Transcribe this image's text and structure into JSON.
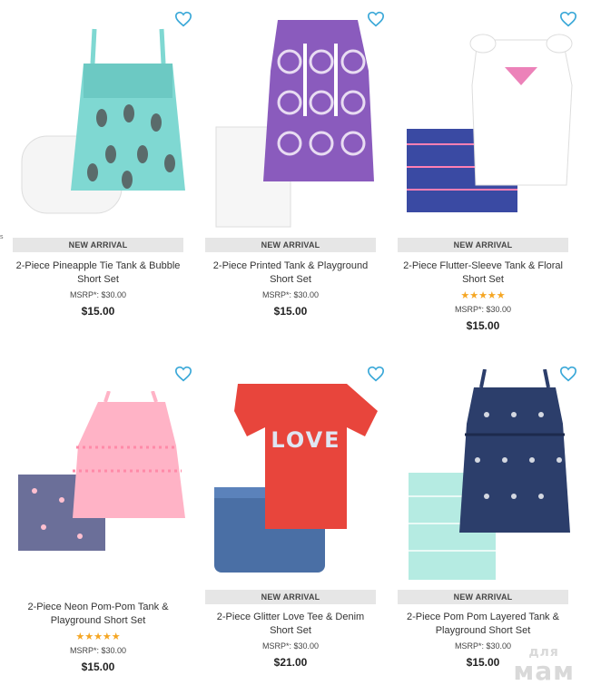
{
  "products": [
    {
      "badge": "NEW ARRIVAL",
      "title_line1": "2-Piece Pineapple Tie Tank & Bubble",
      "title_line2": "Short Set",
      "stars": "",
      "msrp": "MSRP*: $30.00",
      "price": "$15.00",
      "icon": "heart-outline-icon"
    },
    {
      "badge": "NEW ARRIVAL",
      "title_line1": "2-Piece Printed Tank & Playground",
      "title_line2": "Short Set",
      "stars": "",
      "msrp": "MSRP*: $30.00",
      "price": "$15.00",
      "icon": "heart-outline-icon"
    },
    {
      "badge": "NEW ARRIVAL",
      "title_line1": "2-Piece Flutter-Sleeve Tank & Floral",
      "title_line2": "Short Set",
      "stars": "★★★★★",
      "msrp": "MSRP*: $30.00",
      "price": "$15.00",
      "icon": "heart-outline-icon",
      "rating": 5
    },
    {
      "badge": "",
      "title_line1": "2-Piece Neon Pom-Pom Tank &",
      "title_line2": "Playground Short Set",
      "stars": "★★★★★",
      "msrp": "MSRP*: $30.00",
      "price": "$15.00",
      "icon": "heart-outline-icon",
      "rating": 5
    },
    {
      "badge": "NEW ARRIVAL",
      "title_line1": "2-Piece Glitter Love Tee & Denim",
      "title_line2": "Short Set",
      "stars": "",
      "msrp": "MSRP*: $30.00",
      "price": "$21.00",
      "icon": "heart-outline-icon",
      "image_text": "LOVE"
    },
    {
      "badge": "NEW ARRIVAL",
      "title_line1": "2-Piece Pom Pom Layered Tank &",
      "title_line2": "Playground Short Set",
      "stars": "",
      "msrp": "MSRP*: $30.00",
      "price": "$15.00",
      "icon": "heart-outline-icon"
    }
  ],
  "watermark": {
    "line1": "для",
    "line2": "мам"
  },
  "edge_fragment": "s",
  "colors": {
    "heart": "#3aa8d8",
    "badge_bg": "#e6e6e6",
    "stars": "#f5a623",
    "teal": "#7fd8d2",
    "purple": "#8a5bbd",
    "pink": "#ffb3c6",
    "red": "#e8453c",
    "denim": "#4a6fa5",
    "navy": "#2c3e6b"
  }
}
